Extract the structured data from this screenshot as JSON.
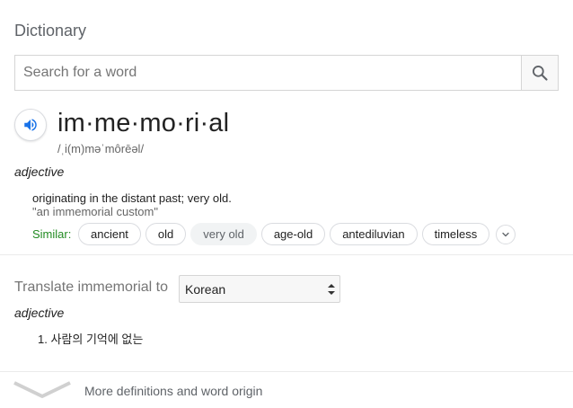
{
  "header": {
    "title": "Dictionary"
  },
  "search": {
    "placeholder": "Search for a word",
    "icon": "search-icon"
  },
  "entry": {
    "speaker_icon": "speaker-icon",
    "word": "im·me·mo·ri·al",
    "phonetic": "/ˌi(m)məˈmôrēəl/",
    "part_of_speech": "adjective",
    "definition": "originating in the distant past; very old.",
    "example": "\"an immemorial custom\"",
    "similar_label": "Similar:",
    "similar": [
      "ancient",
      "old",
      "very old",
      "age-old",
      "antediluvian",
      "timeless"
    ],
    "more_similar_icon": "chevron-down-icon"
  },
  "translate": {
    "label": "Translate immemorial to",
    "language": "Korean",
    "part_of_speech": "adjective",
    "items": [
      "1. 사람의 기억에 없는"
    ]
  },
  "footer": {
    "more_label": "More definitions and word origin",
    "icon": "chevron-down-icon"
  },
  "colors": {
    "accent_blue": "#1a73e8",
    "similar_green": "#228b22",
    "text_gray": "#5f6368"
  }
}
